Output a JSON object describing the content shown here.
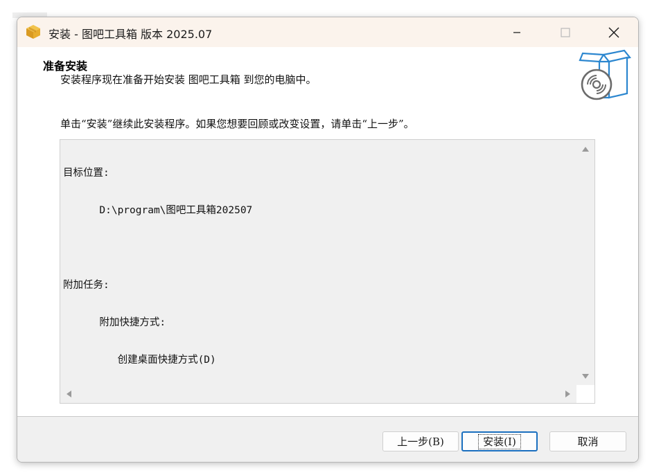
{
  "window": {
    "title": "安装 - 图吧工具箱 版本 2025.07",
    "icon": "package-box-icon",
    "controls": {
      "minimize": "minimize-icon",
      "maximize": "maximize-icon",
      "close": "close-icon"
    }
  },
  "header": {
    "heading": "准备安装",
    "subheading": "安装程序现在准备开始安装 图吧工具箱 到您的电脑中。",
    "icon": "setup-disc-box-icon"
  },
  "instruction": "单击“安装”继续此安装程序。如果您想要回顾或改变设置，请单击“上一步”。",
  "memo": {
    "lines": [
      "目标位置:",
      "      D:\\program\\图吧工具箱202507",
      "",
      "附加任务:",
      "      附加快捷方式:",
      "         创建桌面快捷方式(D)"
    ]
  },
  "buttons": {
    "back": "上一步(B)",
    "install": "安装(I)",
    "cancel": "取消"
  },
  "colors": {
    "titlebar_bg": "#fbf3ec",
    "footer_bg": "#f0f0f0",
    "accent": "#1a6fbf",
    "icon_blue": "#2b86cf"
  }
}
